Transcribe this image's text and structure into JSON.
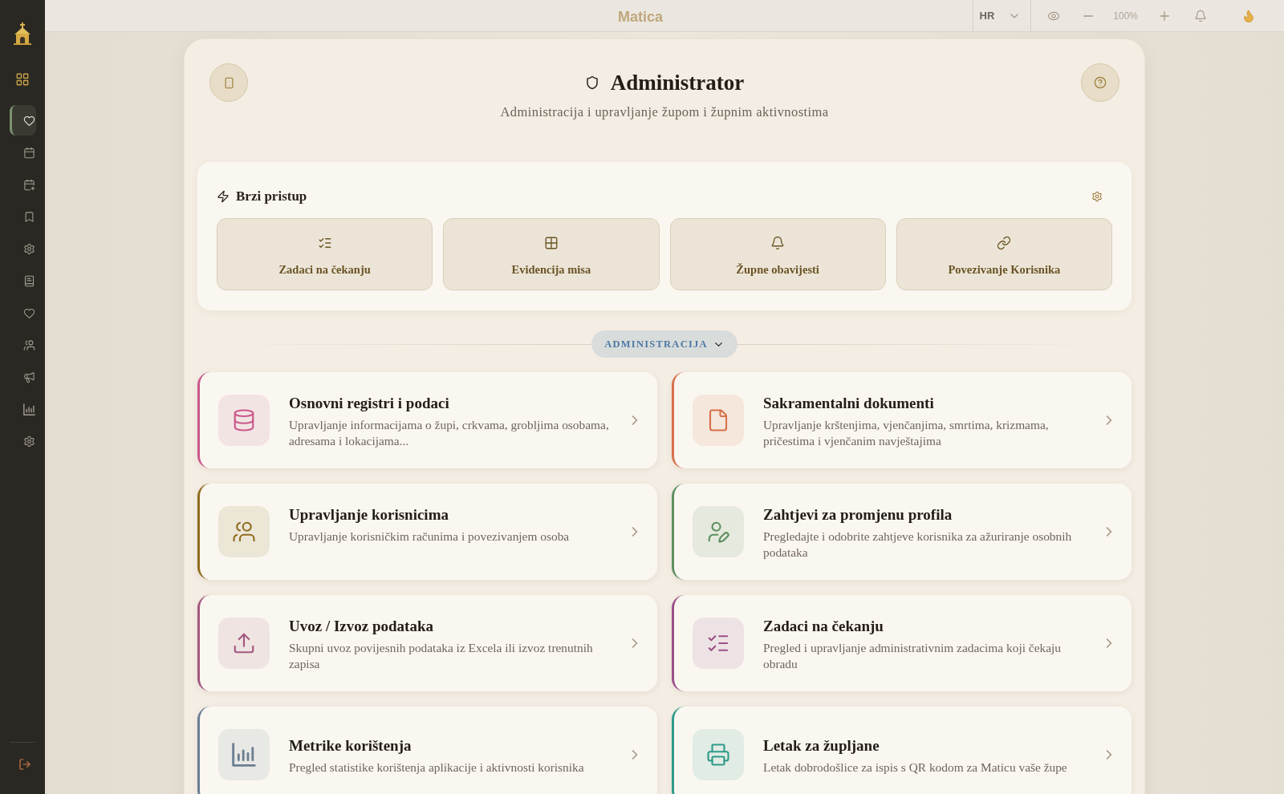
{
  "top_bar": {
    "title": "Matica",
    "language": "HR",
    "zoom": "100%"
  },
  "sidebar": {
    "items": [
      {
        "selected": true
      },
      {
        "selected": false
      },
      {
        "selected": false
      },
      {
        "selected": false
      },
      {
        "selected": false
      },
      {
        "selected": false
      },
      {
        "selected": false
      },
      {
        "selected": false
      },
      {
        "selected": false
      },
      {
        "selected": false
      },
      {
        "selected": false
      }
    ]
  },
  "header": {
    "title": "Administrator",
    "subtitle": "Administracija i upravljanje župom i župnim aktivnostima"
  },
  "quick_access": {
    "title": "Brzi pristup",
    "items": [
      {
        "label": "Zadaci na čekanju"
      },
      {
        "label": "Evidencija misa"
      },
      {
        "label": "Župne obavijesti"
      },
      {
        "label": "Povezivanje Korisnika"
      }
    ]
  },
  "section": {
    "label": "ADMINISTRACIJA",
    "expanded": true
  },
  "cards": [
    {
      "title": "Osnovni registri i podaci",
      "description": "Upravljanje informacijama o župi, crkvama, grobljima osobama, adresama i lokacijama...",
      "color": "#c9588a"
    },
    {
      "title": "Sakramentalni dokumenti",
      "description": "Upravljanje krštenjima, vjenčanjima, smrtima, krizmama, pričestima i vjenčanim navještajima",
      "color": "#d6714b"
    },
    {
      "title": "Upravljanje korisnicima",
      "description": "Upravljanje korisničkim računima i povezivanjem osoba",
      "color": "#8f6c1e"
    },
    {
      "title": "Zahtjevi za promjenu profila",
      "description": "Pregledajte i odobrite zahtjeve korisnika za ažuriranje osobnih podataka",
      "color": "#5c8f5e"
    },
    {
      "title": "Uvoz / Izvoz podataka",
      "description": "Skupni uvoz povijesnih podataka iz Excela ili izvoz trenutnih zapisa",
      "color": "#a2587f"
    },
    {
      "title": "Zadaci na čekanju",
      "description": "Pregled i upravljanje administrativnim zadacima koji čekaju obradu",
      "color": "#9a4f88"
    },
    {
      "title": "Metrike korištenja",
      "description": "Pregled statistike korištenja aplikacije i aktivnosti korisnika",
      "color": "#6b7e92"
    },
    {
      "title": "Letak za župljane",
      "description": "Letak dobrodošlice za ispis s QR kodom za Maticu vaše župe",
      "color": "#2f9a89"
    }
  ]
}
